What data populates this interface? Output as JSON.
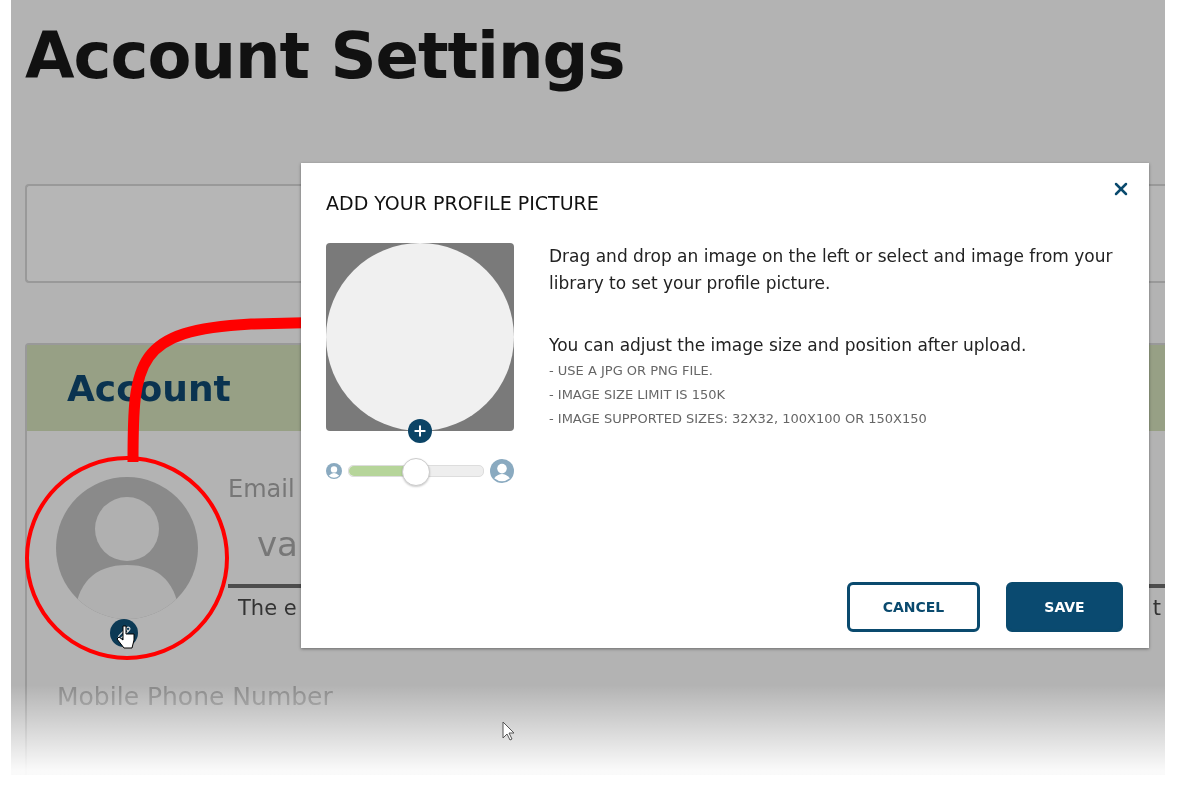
{
  "page": {
    "title": "Account Settings"
  },
  "account_panel": {
    "title": "Account",
    "email_label": "Email",
    "email_value": "va",
    "note": "The e",
    "note_right": "t",
    "mobile_label": "Mobile Phone Number"
  },
  "dialog": {
    "title": "ADD YOUR PROFILE PICTURE",
    "intro": "Drag and drop an image on the left or select and image from your library to set your profile picture.",
    "hint": "You can adjust the image size and position after upload.",
    "rules": [
      "- USE A JPG OR PNG FILE.",
      "- IMAGE SIZE LIMIT IS 150K",
      "- IMAGE SUPPORTED SIZES: 32X32, 100X100 OR 150X150"
    ],
    "zoom": {
      "level": 0.49
    },
    "buttons": [
      {
        "label": "CANCEL",
        "kind": "secondary"
      },
      {
        "label": "SAVE",
        "kind": "primary"
      }
    ]
  }
}
